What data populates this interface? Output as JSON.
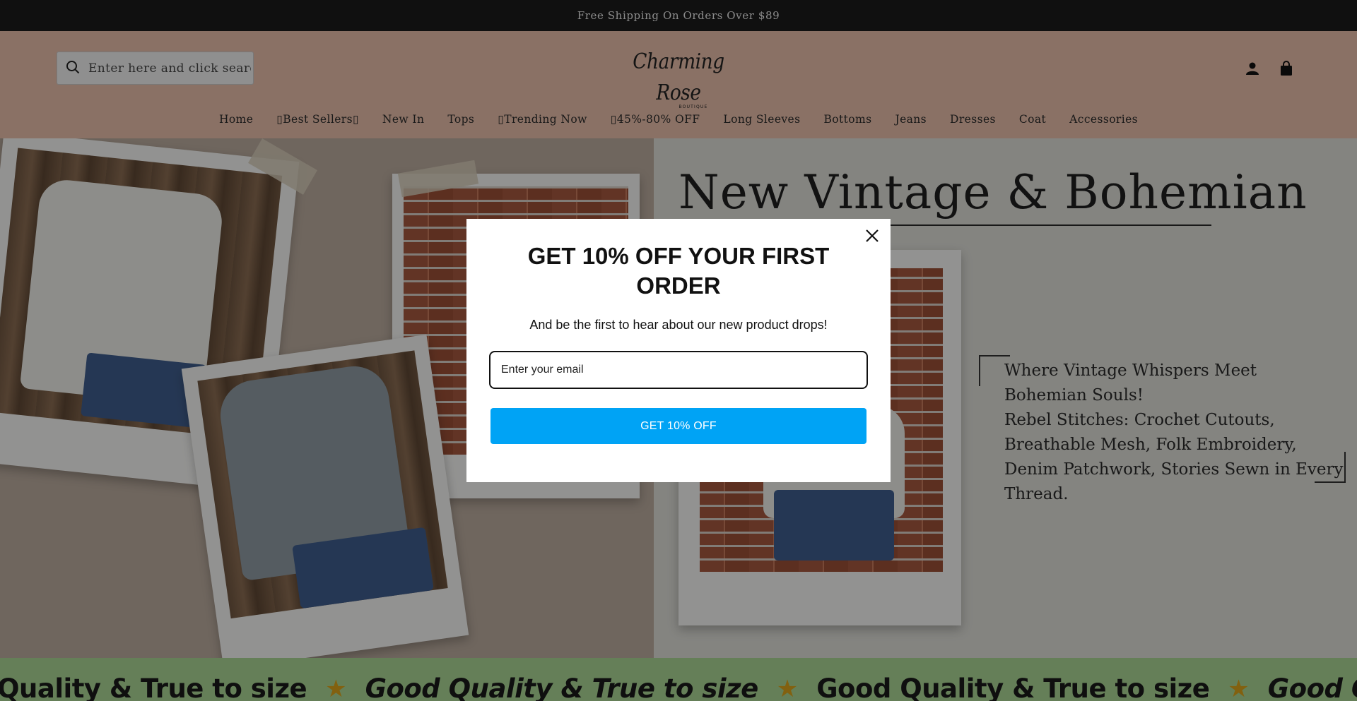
{
  "announcement": {
    "text": "Free Shipping On Orders Over $89"
  },
  "header": {
    "search_placeholder": "Enter here and click search",
    "logo_text": "Charming Rose",
    "logo_subtext": "BOUTIQUE",
    "account_icon": "person-icon",
    "cart_icon": "shopping-bag-icon"
  },
  "nav": {
    "items": [
      {
        "label": "Home"
      },
      {
        "label": "Best Sellers"
      },
      {
        "label": "New In"
      },
      {
        "label": "Tops"
      },
      {
        "label": "Trending Now"
      },
      {
        "label": "45%-80% OFF"
      },
      {
        "label": "Long Sleeves"
      },
      {
        "label": "Bottoms"
      },
      {
        "label": "Jeans"
      },
      {
        "label": "Dresses"
      },
      {
        "label": "Coat"
      },
      {
        "label": "Accessories"
      }
    ]
  },
  "hero": {
    "title": "New Vintage & Bohemian",
    "line1": " Where Vintage Whispers Meet Bohemian Souls!",
    "line2": "Rebel Stitches: Crochet Cutouts, Breathable Mesh, Folk Embroidery, Denim Patchwork, Stories Sewn in Every Thread."
  },
  "marquee": {
    "items": [
      {
        "text": "Good Quality & True to size",
        "italic": false
      },
      {
        "text": "Good Quality & True to size",
        "italic": true
      },
      {
        "text": "Good Quality & True to size",
        "italic": false
      },
      {
        "text": "Good Quality & True to size",
        "italic": true
      }
    ],
    "star": "★",
    "star_color": "#d9a21b",
    "background": "#a9d493"
  },
  "popup": {
    "title": "GET 10% OFF YOUR FIRST ORDER",
    "subtitle": "And be the first to hear about our new product drops!",
    "email_placeholder": "Enter your email",
    "button_label": "GET 10% OFF",
    "button_color": "#00a3f5",
    "close_icon": "close-icon"
  },
  "colors": {
    "announcement_bg": "#1c1c1c",
    "header_bg": "#e7bda8"
  }
}
